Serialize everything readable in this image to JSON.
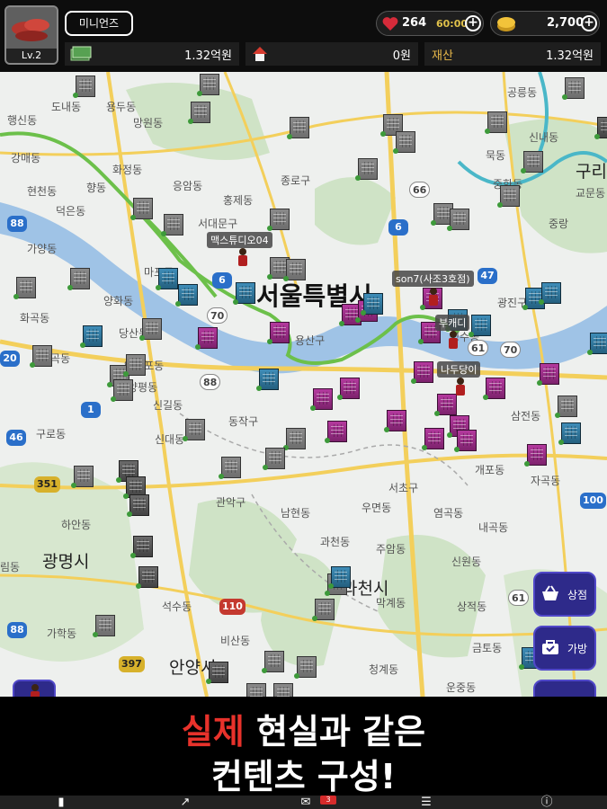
{
  "player": {
    "level": "Lv.2",
    "name": "미니언즈"
  },
  "resources": {
    "hearts": "264",
    "timer": "60:00",
    "gold": "2,700"
  },
  "stats": {
    "cash": "1.32억원",
    "property": "0원",
    "assets_label": "재산",
    "assets": "1.32억원"
  },
  "map": {
    "labels": [
      "도내동",
      "용두동",
      "공릉동",
      "행신동",
      "망원동",
      "신내동",
      "강매동",
      "화정동",
      "묵동",
      "현천동",
      "향동",
      "중화동",
      "구리",
      "덕은동",
      "응암동",
      "교문동",
      "홍제동",
      "종로구",
      "서대문구",
      "중랑",
      "가양동",
      "서울특별시",
      "광진구",
      "마포구",
      "양화동",
      "화곡동",
      "당산동",
      "용산구",
      "성수동",
      "능곡동",
      "영등포동",
      "양평동",
      "신길동",
      "삼전동",
      "구로동",
      "신대동",
      "동작구",
      "개포동",
      "자곡동",
      "서초구",
      "우면동",
      "염곡동",
      "관악구",
      "남현동",
      "내곡동",
      "과천동",
      "주암동",
      "신원동",
      "광명시",
      "하안동",
      "석수동",
      "막계동",
      "상적동",
      "가학동",
      "비산동",
      "청계동",
      "금토동",
      "안양시",
      "운중동",
      "과천시",
      "림동"
    ],
    "routes": [
      "88",
      "6",
      "70",
      "66",
      "47",
      "61",
      "88",
      "1",
      "46",
      "351",
      "110",
      "397",
      "100",
      "20",
      "6",
      "61",
      "70",
      "88"
    ],
    "players": [
      "맥스튜디오04",
      "son7(사조3호점)",
      "부캐디",
      "나두당이"
    ]
  },
  "side_buttons": {
    "shop": "상점",
    "bag": "가방"
  },
  "banner": {
    "line1_highlight": "실제",
    "line1_rest": " 현실과 같은",
    "line2": "컨텐츠 구성!"
  },
  "nav": {
    "mail_badge": "3"
  },
  "colors": {
    "accent_red": "#e8322b",
    "button_purple": "#2e2a8a",
    "building_magenta": "#9a2d86"
  }
}
